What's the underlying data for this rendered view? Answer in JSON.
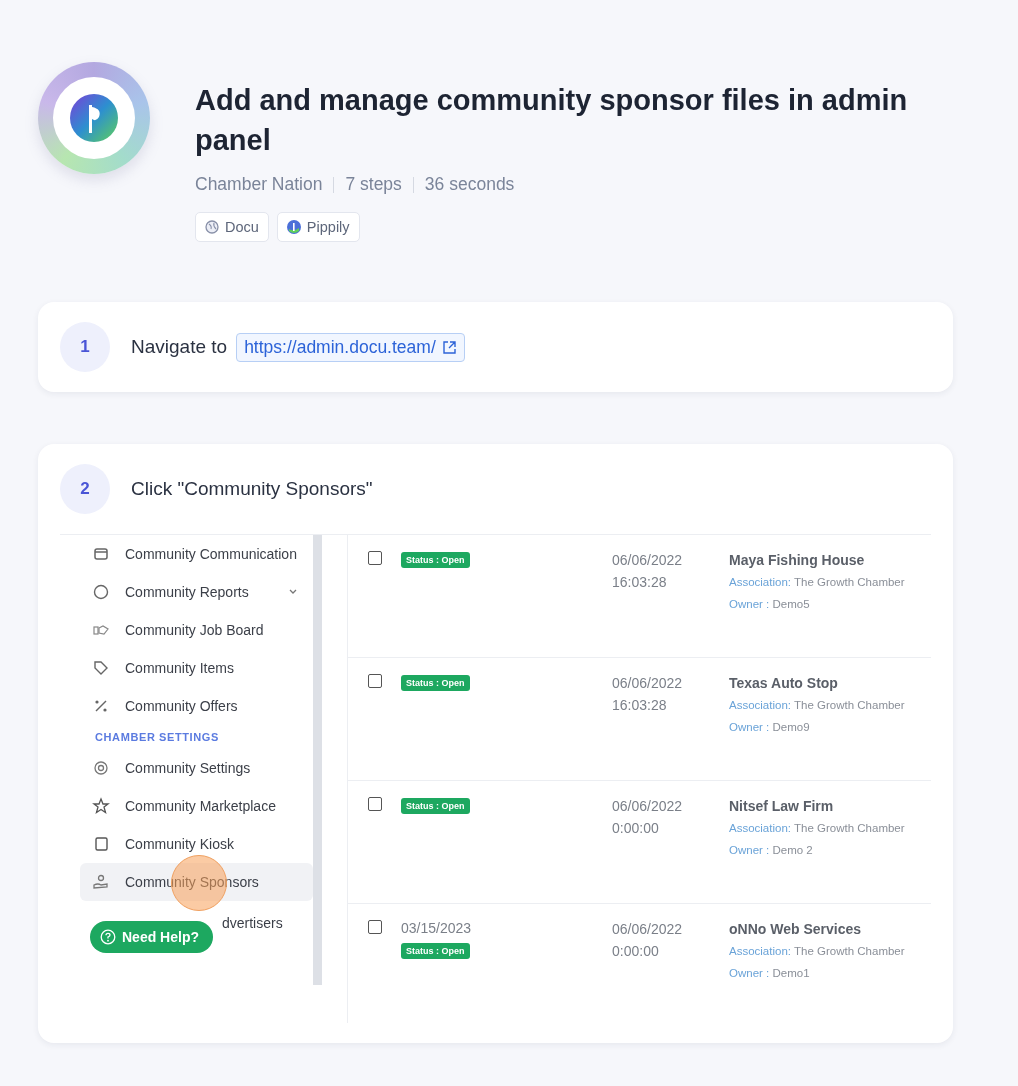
{
  "guide": {
    "title": "Add and manage community sponsor files in admin panel",
    "meta": [
      "Chamber Nation",
      "7 steps",
      "36 seconds"
    ],
    "tags": [
      {
        "label": "Docu",
        "kind": "globe"
      },
      {
        "label": "Pippily",
        "kind": "logo"
      }
    ]
  },
  "steps": [
    {
      "number": "1",
      "text": "Navigate to",
      "link": "https://admin.docu.team/"
    },
    {
      "number": "2",
      "text": "Click \"Community Sponsors\"",
      "screenshot": {
        "sidebar": [
          {
            "kind": "item",
            "label": "Community Communication",
            "submenu": false,
            "selected": false
          },
          {
            "kind": "item",
            "label": "Community Reports",
            "submenu": true,
            "selected": false
          },
          {
            "kind": "item",
            "label": "Community Job Board",
            "submenu": false,
            "selected": false
          },
          {
            "kind": "item",
            "label": "Community Items",
            "submenu": false,
            "selected": false
          },
          {
            "kind": "item",
            "label": "Community Offers",
            "submenu": false,
            "selected": false
          },
          {
            "kind": "section",
            "label": "CHAMBER SETTINGS"
          },
          {
            "kind": "item",
            "label": "Community Settings",
            "submenu": false,
            "selected": false
          },
          {
            "kind": "item",
            "label": "Community Marketplace",
            "submenu": false,
            "selected": false
          },
          {
            "kind": "item",
            "label": "Community Kiosk",
            "submenu": false,
            "selected": false
          },
          {
            "kind": "item",
            "label": "Community Sponsors",
            "submenu": false,
            "selected": true
          },
          {
            "kind": "covered",
            "label": "dvertisers",
            "submenu": false,
            "selected": false
          }
        ],
        "help_button": "Need Help?",
        "rows": [
          {
            "checked": false,
            "status": "Status : Open",
            "date": "06/06/2022",
            "time": "16:03:28",
            "name": "Maya Fishing House",
            "association_label": "Association:",
            "association": "The Growth Chamber",
            "owner_label": "Owner :",
            "owner": "Demo5"
          },
          {
            "checked": false,
            "status": "Status : Open",
            "date": "06/06/2022",
            "time": "16:03:28",
            "name": "Texas Auto Stop",
            "association_label": "Association:",
            "association": "The Growth Chamber",
            "owner_label": "Owner :",
            "owner": "Demo9"
          },
          {
            "checked": false,
            "status": "Status : Open",
            "date": "06/06/2022",
            "time": "0:00:00",
            "name": "Nitsef Law Firm",
            "association_label": "Association:",
            "association": "The Growth Chamber",
            "owner_label": "Owner :",
            "owner": "Demo 2"
          },
          {
            "checked": false,
            "created": "03/15/2023",
            "status": "Status : Open",
            "date": "06/06/2022",
            "time": "0:00:00",
            "name": "oNNo Web Services",
            "association_label": "Association:",
            "association": "The Growth Chamber",
            "owner_label": "Owner :",
            "owner": "Demo1"
          }
        ]
      }
    }
  ]
}
